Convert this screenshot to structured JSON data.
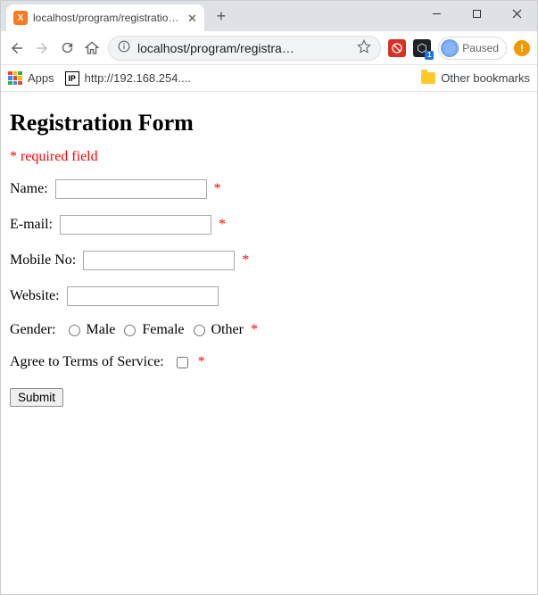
{
  "window": {
    "tab_title": "localhost/program/registration.p",
    "url_display": "localhost/program/registra…",
    "avatar_label": "Paused",
    "ext2_badge": "1"
  },
  "bookmarks": {
    "apps_label": "Apps",
    "ip_label": "http://192.168.254....",
    "other_label": "Other bookmarks"
  },
  "form": {
    "heading": "Registration Form",
    "required_note": "* required field",
    "name_label": "Name:",
    "email_label": "E-mail:",
    "mobile_label": "Mobile No:",
    "website_label": "Website:",
    "gender_label": "Gender:",
    "gender_male": "Male",
    "gender_female": "Female",
    "gender_other": "Other",
    "tos_label": "Agree to Terms of Service:",
    "submit_label": "Submit",
    "asterisk": "*"
  }
}
